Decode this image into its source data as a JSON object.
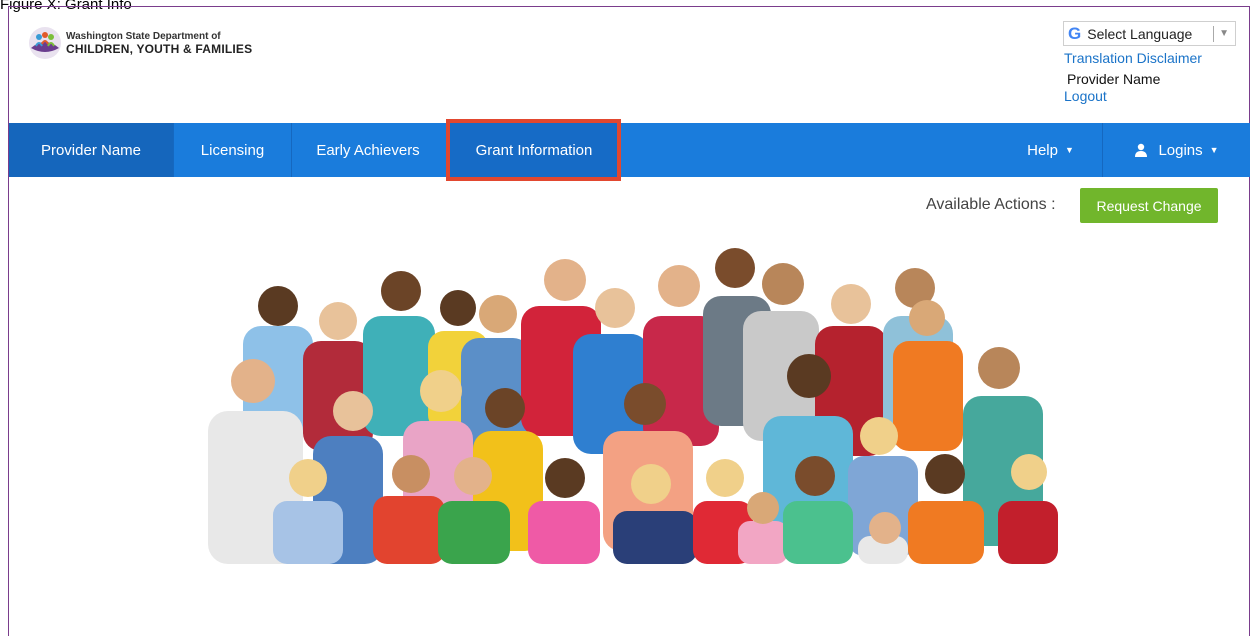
{
  "caption": "Figure X: Grant Info",
  "header": {
    "logo_line1": "Washington State Department of",
    "logo_line2": "CHILDREN, YOUTH & FAMILIES",
    "language_select": "Select Language",
    "translation_disclaimer": "Translation Disclaimer",
    "provider_name": "Provider Name",
    "logout": "Logout"
  },
  "nav": {
    "provider": "Provider Name",
    "licensing": "Licensing",
    "early_achievers": "Early Achievers",
    "grant_information": "Grant Information",
    "help": "Help",
    "logins": "Logins"
  },
  "actions": {
    "label": "Available Actions :",
    "request_change": "Request Change"
  },
  "colors": {
    "nav_bg": "#1a7cdc",
    "nav_active": "#1566bc",
    "highlight": "#e2472f",
    "button": "#71b62c",
    "link": "#1a73c8"
  }
}
